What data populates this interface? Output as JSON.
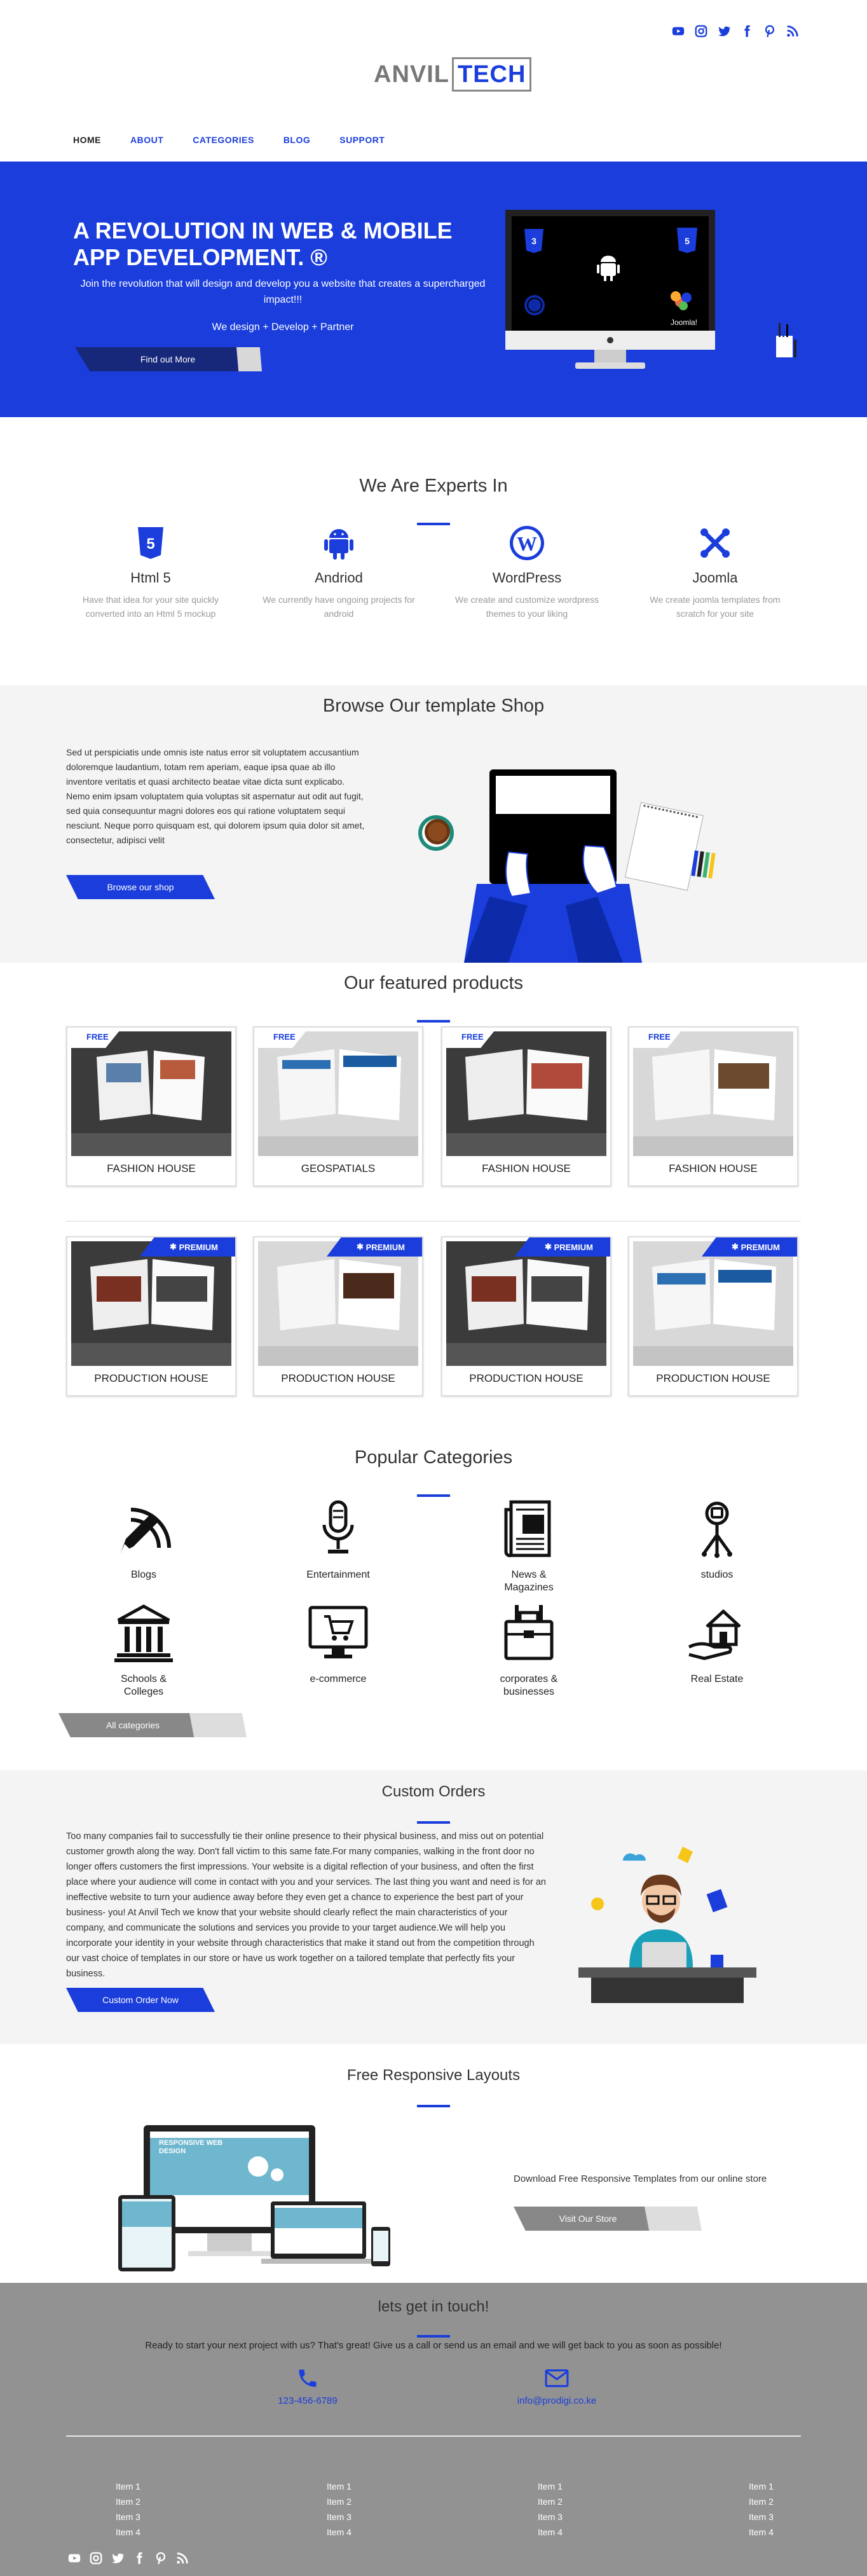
{
  "header": {
    "social": [
      "youtube-icon",
      "instagram-icon",
      "twitter-icon",
      "facebook-icon",
      "pinterest-icon",
      "rss-icon"
    ],
    "logo_left": "ANVIL",
    "logo_right": "TECH",
    "nav": [
      "HOME",
      "ABOUT",
      "CATEGORIES",
      "BLOG",
      "SUPPORT"
    ]
  },
  "hero": {
    "title": "A REVOLUTION IN WEB & MOBILE APP DEVELOPMENT. ®",
    "subtitle": "Join the revolution that will design and develop you a website that creates a supercharged impact!!!",
    "tagline": "We design + Develop + Partner",
    "cta": "Find out More",
    "screen_label": "Joomla!"
  },
  "experts": {
    "title": "We Are Experts In",
    "items": [
      {
        "name": "Html 5",
        "desc": "Have that idea for your site quickly converted into an Html 5 mockup"
      },
      {
        "name": "Andriod",
        "desc": "We currently have ongoing projects for android"
      },
      {
        "name": "WordPress",
        "desc": "We create and customize wordpress themes to your liking"
      },
      {
        "name": "Joomla",
        "desc": "We create joomla templates from scratch for your site"
      }
    ]
  },
  "shop": {
    "title": "Browse Our template Shop",
    "desc": "Sed ut perspiciatis unde omnis iste natus error sit voluptatem accusantium doloremque laudantium, totam rem aperiam, eaque ipsa quae ab illo inventore veritatis et quasi architecto beatae vitae dicta sunt explicabo. Nemo enim ipsam voluptatem quia voluptas sit aspernatur aut odit aut fugit, sed quia consequuntur magni dolores eos qui ratione voluptatem sequi nesciunt. Neque porro quisquam est, qui dolorem ipsum quia dolor sit amet, consectetur, adipisci velit",
    "cta": "Browse our shop"
  },
  "featured": {
    "title": "Our featured products",
    "free_label": "FREE",
    "premium_label": "PREMIUM",
    "free": [
      "FASHION HOUSE",
      "GEOSPATIALS",
      "FASHION HOUSE",
      "FASHION HOUSE"
    ],
    "premium": [
      "PRODUCTION HOUSE",
      "PRODUCTION HOUSE",
      "PRODUCTION HOUSE",
      "PRODUCTION HOUSE"
    ]
  },
  "categories": {
    "title": "Popular Categories",
    "items": [
      "Blogs",
      "Entertainment",
      "News & Magazines",
      "studios",
      "Schools & Colleges",
      "e-commerce",
      "corporates & businesses",
      "Real Estate"
    ],
    "cta": "All categories"
  },
  "custom": {
    "title": "Custom Orders",
    "desc": "Too many companies fail to successfully tie their online presence to their physical business, and miss out on potential customer growth along the way. Don't fall victim to this same fate.For many companies, walking in the front door no longer offers customers the first impressions. Your website is a digital reflection of your business, and often the first place where your audience will come in contact with you and your services. The last thing you want and need is for an ineffective website to turn your audience away before they even get a chance to experience the best part of your business- you! At Anvil Tech we know that your website should clearly reflect the main characteristics of your company, and communicate the solutions and services you provide to your target audience.We will help you incorporate your identity in your website through characteristics that make it stand out from the competition through our vast choice of templates in our store or have us work together on a tailored template that perfectly fits your business.",
    "cta": "Custom Order Now"
  },
  "responsive": {
    "title": "Free Responsive Layouts",
    "text": "Download Free Responsive Templates from our online store",
    "cta": "Visit Our Store",
    "screen_text": "RESPONSIVE WEB DESIGN"
  },
  "contact": {
    "title": "lets get in touch!",
    "lead": "Ready to start your next project with us? That's great! Give us a call or send us an email and we will get back to you as soon as possible!",
    "phone": "123-456-6789",
    "email": "info@prodigi.co.ke",
    "footer_cols": [
      [
        "Item 1",
        "Item 2",
        "Item 3",
        "Item 4"
      ],
      [
        "Item 1",
        "Item 2",
        "Item 3",
        "Item 4"
      ],
      [
        "Item 1",
        "Item 2",
        "Item 3",
        "Item 4"
      ],
      [
        "Item 1",
        "Item 2",
        "Item 3",
        "Item 4"
      ]
    ]
  },
  "colors": {
    "accent": "#1a3ddb",
    "footer": "#929292",
    "gray_section": "#f4f4f4"
  }
}
